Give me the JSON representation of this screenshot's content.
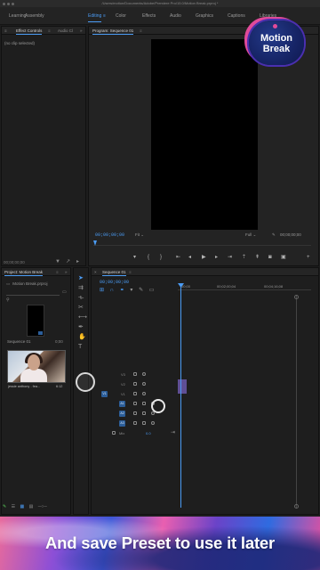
{
  "window": {
    "title": "/Users/motion/Documents/Adobe/Premiere Pro/15.0/Motion Break.prproj *"
  },
  "workspaces": {
    "items": [
      {
        "label": "Learning"
      },
      {
        "label": "Assembly"
      },
      {
        "label": "Editing"
      },
      {
        "label": "Color"
      },
      {
        "label": "Effects"
      },
      {
        "label": "Audio"
      },
      {
        "label": "Graphics"
      },
      {
        "label": "Captions"
      },
      {
        "label": "Libraries"
      }
    ],
    "active": "Editing"
  },
  "effect_controls": {
    "tab_label": "Effect Controls",
    "tab2_label": "Audio Cl",
    "empty_text": "(no clip selected)",
    "timecode": "00;00;00;00"
  },
  "program_monitor": {
    "title": "Program: Sequence 01",
    "timecode": "00;00;00;00",
    "fit_label": "Fit",
    "quality_label": "Full",
    "duration": "00;00;00;00"
  },
  "project_panel": {
    "title": "Project: Motion Break",
    "file_label": "Motion Break.prproj",
    "items": [
      {
        "name": "Sequence 01",
        "duration": "0;00"
      },
      {
        "name": "jessie anthony - fea...",
        "duration": "6:12"
      }
    ]
  },
  "timeline": {
    "title": "Sequence 01",
    "timecode": "00;00;00;00",
    "ruler_labels": [
      "00;00",
      "00;02;00;04",
      "00;04;16;08"
    ],
    "tracks": [
      {
        "label": "V3",
        "patch": ""
      },
      {
        "label": "V2",
        "patch": ""
      },
      {
        "label": "V1",
        "patch": "V1"
      },
      {
        "label": "A1",
        "patch": "A1"
      },
      {
        "label": "A2",
        "patch": "A2"
      },
      {
        "label": "A3",
        "patch": "A3"
      },
      {
        "label": "Mix",
        "patch": ""
      }
    ],
    "mix_value": "0.0"
  },
  "logo": {
    "line1": "Motion",
    "line2": "Break"
  },
  "banner": {
    "text": "And save Preset to use it later"
  },
  "colors": {
    "accent": "#4b9cf5",
    "patch": "#2c5e99",
    "logo_bg": "#162465",
    "logo_accent": "#e14a9a"
  }
}
